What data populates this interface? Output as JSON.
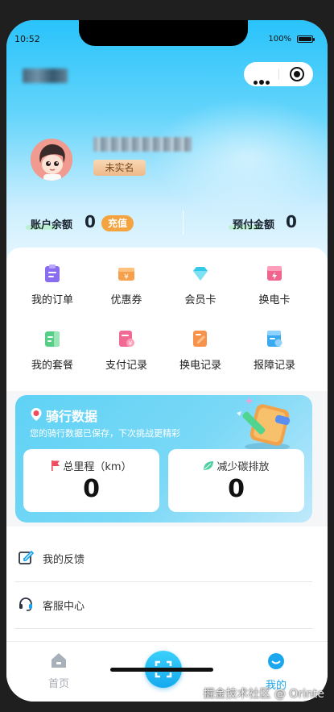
{
  "status_bar": {
    "time": "10:52",
    "battery": "100%"
  },
  "profile": {
    "verify_badge": "未实名"
  },
  "balance": {
    "account_label": "账户余额",
    "account_value": "0",
    "recharge_label": "充值",
    "prepaid_label": "预付金额",
    "prepaid_value": "0"
  },
  "menu": [
    {
      "label": "我的订单",
      "icon": "clipboard-icon",
      "color": "#8a6cf0"
    },
    {
      "label": "优惠券",
      "icon": "coupon-icon",
      "color": "#f7a04b"
    },
    {
      "label": "会员卡",
      "icon": "diamond-icon",
      "color": "#33c9e8"
    },
    {
      "label": "换电卡",
      "icon": "lightning-card-icon",
      "color": "#f0648e"
    },
    {
      "label": "我的套餐",
      "icon": "package-icon",
      "color": "#55cf85"
    },
    {
      "label": "支付记录",
      "icon": "payment-record-icon",
      "color": "#f06a94"
    },
    {
      "label": "换电记录",
      "icon": "swap-record-icon",
      "color": "#f7924b"
    },
    {
      "label": "报障记录",
      "icon": "fault-record-icon",
      "color": "#3aaaf0"
    }
  ],
  "ride_data": {
    "title": "骑行数据",
    "subtitle": "您的骑行数据已保存，下次挑战更精彩",
    "distance_label": "总里程（km）",
    "distance_value": "0",
    "carbon_label": "减少碳排放",
    "carbon_value": "0"
  },
  "list": [
    {
      "label": "我的反馈",
      "icon": "edit-icon"
    },
    {
      "label": "客服中心",
      "icon": "headset-icon"
    }
  ],
  "tabbar": {
    "home": "首页",
    "mine": "我的",
    "accent": "#1aa7ee"
  },
  "watermark": "掘金技术社区 @ Orinte"
}
